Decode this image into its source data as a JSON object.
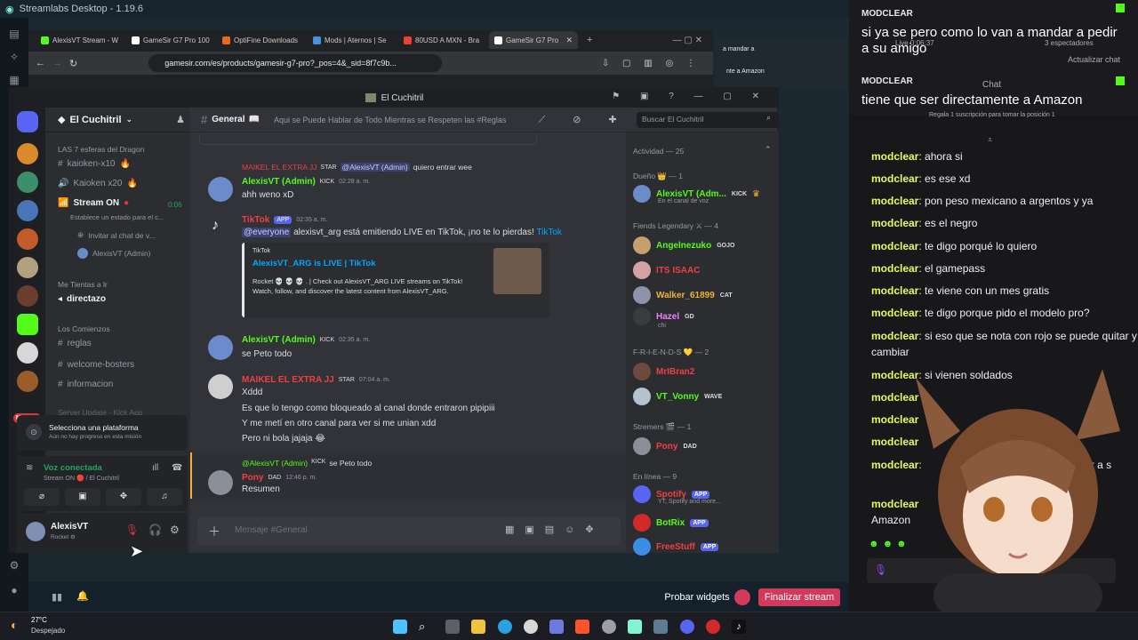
{
  "streamlabs": {
    "title": "Streamlabs Desktop - 1.19.6",
    "probar_widgets": "Probar widgets",
    "finalizar_stream": "Finalizar stream",
    "actualizar_chat": "Actualizar chat",
    "chat_label": "Chat",
    "live_time": "Live 0:06:37",
    "viewers": "3 espectadores",
    "sub_goal": "Regala 1 suscripción para tomar la posición 1"
  },
  "browser": {
    "tabs": [
      {
        "label": "AlexisVT Stream - W",
        "color": "#53fc18"
      },
      {
        "label": "GameSir G7 Pro 100",
        "color": "#ffffff"
      },
      {
        "label": "OptiFine Downloads",
        "color": "#e86a21"
      },
      {
        "label": "Mods | Aternos | Se",
        "color": "#4a90e2"
      },
      {
        "label": "80USD A MXN - Bra",
        "color": "#e94235"
      },
      {
        "label": "GameSir G7 Pro",
        "color": "#ffffff"
      }
    ],
    "url": "gamesir.com/es/products/gamesir-g7-pro?_pos=4&_sid=8f7c9b...",
    "side_text_1": "a mandar a",
    "side_text_2": "nte a Amazon"
  },
  "discord": {
    "window_title": "El Cuchitril",
    "server_name": "El Cuchitril",
    "channel_name": "General",
    "channel_topic": "Aqui se Puede Hablar de Todo Mientras se Respeten las #Reglas",
    "search_placeholder": "Buscar El Cuchitril",
    "channel_list": {
      "cat1": "LAS 7 esferas del Dragon",
      "ch_kaioken_x10": "kaioken-x10",
      "ch_kaioken_x20": "Kaioken x20",
      "ch_stream_on": "Stream ON",
      "stream_time": "0:06",
      "stream_status": "Establece un estado para el c...",
      "invite_chat": "Invitar al chat de v...",
      "voice_user": "AlexisVT (Admin)",
      "cat2": "Me Tientas a lr",
      "ch_directazo": "directazo",
      "cat3": "Los Comienzos",
      "ch_reglas": "reglas",
      "ch_welcome": "welcome-bosters",
      "ch_informacion": "informacion",
      "nuevo": "NUEVO",
      "cat4": "Server Update - Kick App"
    },
    "platform_popup": {
      "title": "Selecciona una plataforma",
      "subtitle": "Aún no hay progreso en esta misión"
    },
    "voice": {
      "status": "Voz conectada",
      "location": "Stream ON 🔴 / El Cuchitril"
    },
    "user": {
      "name": "AlexisVT",
      "status": "Rocket ⚙"
    },
    "messages": {
      "reply_top_user": "MAIKEL EL EXTRA JJ",
      "reply_top_badge": "STAR",
      "reply_top_mention": "@AlexisVT (Admin)",
      "reply_top_text": "quiero entrar wee",
      "m1_name": "AlexisVT (Admin)",
      "m1_badge": "KICK",
      "m1_time": "02:28 a. m.",
      "m1_text": "ahh weno xD",
      "m2_name": "TikTok",
      "m2_tag": "APP",
      "m2_time": "02:35 a. m.",
      "m2_mention": "@everyone",
      "m2_text": "alexisvt_arg está emitiendo LIVE en TikTok, ¡no te lo pierdas!",
      "m2_link": "TikTok",
      "embed_provider": "TikTok",
      "embed_title": "AlexisVT_ARG is LIVE | TikTok",
      "embed_desc": "Rocket 💀 💀 💀 . | Check out AlexisVT_ARG LIVE streams on TikTok! Watch, follow, and discover the latest content from AlexisVT_ARG.",
      "m3_name": "AlexisVT (Admin)",
      "m3_badge": "KICK",
      "m3_time": "02:35 a. m.",
      "m3_text": "se Peto todo",
      "m4_name": "MAIKEL EL EXTRA JJ",
      "m4_badge": "STAR",
      "m4_time": "07:04 a. m.",
      "m4_l1": "Xddd",
      "m4_l2": "Es que lo tengo como bloqueado al canal donde entraron pipipiii",
      "m4_l3": "Y me metí en otro canal para ver si me unian xdd",
      "m4_l4": "Pero ni bola jajaja 😂",
      "reply2_user": "@AlexisVT (Admin)",
      "reply2_badge": "KICK",
      "reply2_text": "se Peto todo",
      "m5_name": "Pony",
      "m5_badge": "DAD",
      "m5_time": "12:46 p. m.",
      "m5_text": "Resumen",
      "input_placeholder": "Mensaje #General"
    },
    "members": {
      "activity": "Actividad — 25",
      "cat_dueno": "Dueño 👑 — 1",
      "owner_name": "AlexisVT (Adm...",
      "owner_badge": "KICK",
      "owner_status": "En el canal de voz",
      "cat_legendary": "Fiends Legendary ⚔ — 4",
      "leg1": "Angelnezuko",
      "leg1_badge": "GOJO",
      "leg2": "ITS ISAAC",
      "leg3": "Walker_61899",
      "leg3_badge": "CAT",
      "leg4": "Hazel",
      "leg4_badge": "GD",
      "leg4_status": "chi",
      "cat_friends": "F-R-I-E-N-D-S 💛 — 2",
      "fr1": "MrIBran2",
      "fr2": "VT_Vonny",
      "fr2_badge": "WAVE",
      "cat_streamers": "Stremers 🎬 — 1",
      "st1": "Pony",
      "st1_badge": "DAD",
      "cat_online": "En línea — 9",
      "on1": "Spotify",
      "on1_tag": "APP",
      "on1_status": "YT, Spotify and more...",
      "on2": "BotRix",
      "on2_tag": "APP",
      "on3": "FreeStuff",
      "on3_tag": "APP"
    }
  },
  "twitch_chat": {
    "alerts": [
      {
        "user": "MODCLEAR",
        "text": "si ya se pero como lo van a mandar a pedir a su amigo"
      },
      {
        "user": "MODCLEAR",
        "text": "tiene que ser directamente a Amazon"
      }
    ],
    "messages": [
      {
        "user": "modclear",
        "text": "ahora si"
      },
      {
        "user": "modclear",
        "text": "es ese xd"
      },
      {
        "user": "modclear",
        "text": "pon peso mexicano a argentos y ya"
      },
      {
        "user": "modclear",
        "text": "es el negro"
      },
      {
        "user": "modclear",
        "text": "te digo porqué lo quiero"
      },
      {
        "user": "modclear",
        "text": "el gamepass"
      },
      {
        "user": "modclear",
        "text": "te viene con un mes gratis"
      },
      {
        "user": "modclear",
        "text": "te digo porque pido el modelo pro?"
      },
      {
        "user": "modclear",
        "text": "si eso que se nota con rojo se puede quitar y cambiar"
      },
      {
        "user": "modclear",
        "text": "si vienen soldados"
      },
      {
        "user": "modclear",
        "text": ""
      },
      {
        "user": "modclear",
        "text": ""
      },
      {
        "user": "modclear",
        "text": ""
      },
      {
        "user": "modclear",
        "text": "andar a pedir a s"
      },
      {
        "user": "modclear",
        "text": "Amazon"
      }
    ]
  },
  "taskbar": {
    "weather_temp": "27°C",
    "weather_desc": "Despejado"
  }
}
